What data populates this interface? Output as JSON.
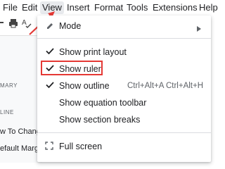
{
  "menubar": {
    "items": [
      "File",
      "Edit",
      "View",
      "Insert",
      "Format",
      "Tools",
      "Extensions",
      "Help"
    ]
  },
  "outline": {
    "summary_label": "MARY",
    "outline_label": "LINE",
    "heading1": "w To Change",
    "heading2": "efault Margi"
  },
  "view_menu": {
    "mode": "Mode",
    "show_print_layout": "Show print layout",
    "show_ruler": "Show ruler",
    "show_outline": "Show outline",
    "show_outline_shortcut": "Ctrl+Alt+A Ctrl+Alt+H",
    "show_equation_toolbar": "Show equation toolbar",
    "show_section_breaks": "Show section breaks",
    "full_screen": "Full screen"
  },
  "colors": {
    "annotation": "#e53935",
    "menu_text": "#202124",
    "shortcut_text": "#5f6368"
  }
}
